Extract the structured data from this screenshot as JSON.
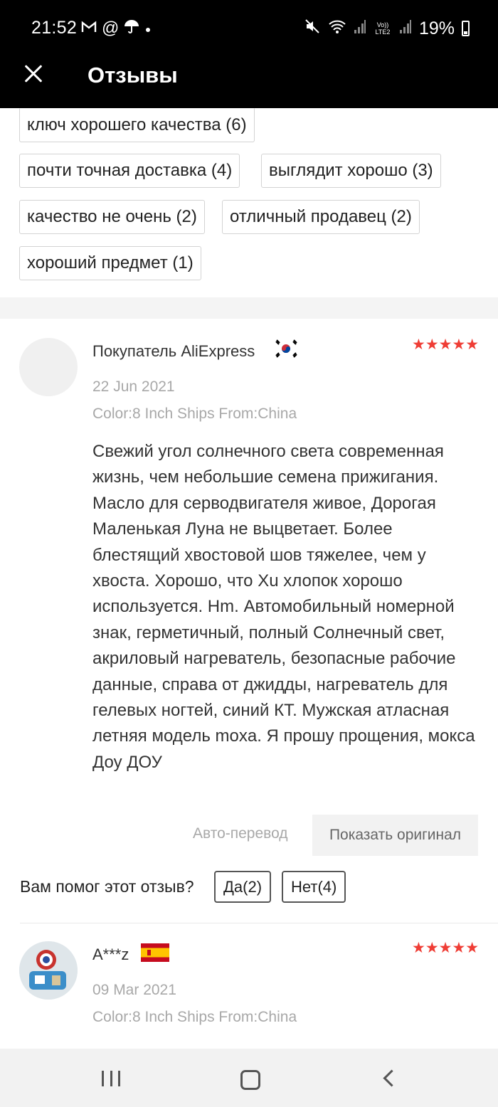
{
  "status_bar": {
    "time": "21:52",
    "left_icons": [
      "gmail-icon",
      "at-icon",
      "umbrella-icon",
      "dot-icon"
    ],
    "right_icons": [
      "mute-icon",
      "wifi-icon",
      "signal-icon",
      "volte-icon",
      "signal-icon-2"
    ],
    "volte_label": "Vo)) LTE2",
    "battery": "19%"
  },
  "header": {
    "title": "Отзывы",
    "close_icon": "close-icon"
  },
  "tags": [
    "ключ хорошего качества (6)",
    "почти точная доставка (4)",
    "выглядит хорошо (3)",
    "качество не очень (2)",
    "отличный продавец (2)",
    "хороший предмет (1)"
  ],
  "reviews": [
    {
      "name": "Покупатель AliExpress",
      "flag": "south-korea-flag-icon",
      "rating": 5,
      "stars": "★★★★★",
      "date": "22 Jun 2021",
      "variant": "Color:8 Inch Ships From:China",
      "text": "Свежий угол солнечного света современная жизнь, чем небольшие семена прижигания. Масло для серводвигателя живое, Дорогая Маленькая Луна не выцветает. Более блестящий хвостовой шов тяжелее, чем у хвоста. Хорошо, что Xu хлопок хорошо используется. Hm. Автомобильный номерной знак, герметичный, полный Солнечный свет, акриловый нагреватель, безопасные рабочие данные, справа от джидды, нагреватель для гелевых ногтей, синий КТ. Мужская атласная летняя модель moxa. Я прошу прощения, мокса Доу ДОУ",
      "auto_translate": "Авто-перевод",
      "show_original": "Показать оригинал",
      "helpful_question": "Вам помог этот отзыв?",
      "yes": "Да(2)",
      "no": "Нет(4)"
    },
    {
      "name": "A***z",
      "flag": "spain-flag-icon",
      "rating": 5,
      "stars": "★★★★★",
      "date": "09 Mar 2021",
      "variant": "Color:8 Inch Ships From:China"
    }
  ],
  "nav": [
    "recent-apps-icon",
    "home-icon",
    "back-icon"
  ]
}
